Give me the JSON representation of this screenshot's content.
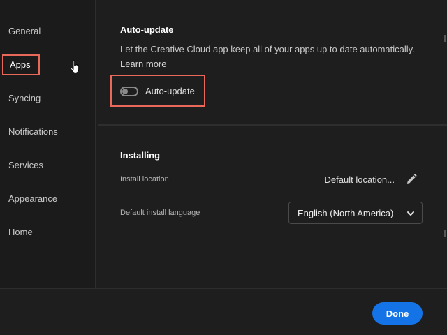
{
  "sidebar": {
    "items": [
      {
        "label": "General"
      },
      {
        "label": "Apps"
      },
      {
        "label": "Syncing"
      },
      {
        "label": "Notifications"
      },
      {
        "label": "Services"
      },
      {
        "label": "Appearance"
      },
      {
        "label": "Home"
      }
    ],
    "active_index": 1
  },
  "autoupdate_section": {
    "title": "Auto-update",
    "description": "Let the Creative Cloud app keep all of your apps up to date automatically.",
    "learn_more": "Learn more",
    "toggle_label": "Auto-update",
    "toggle_on": false
  },
  "installing_section": {
    "title": "Installing",
    "install_location_label": "Install location",
    "install_location_value": "Default location...",
    "language_label": "Default install language",
    "language_value": "English (North America)"
  },
  "footer": {
    "done_label": "Done"
  },
  "colors": {
    "accent": "#1473e6",
    "highlight": "#e8685a"
  },
  "icons": {
    "edit": "pencil-icon",
    "dropdown": "chevron-down-icon",
    "cursor": "hand-cursor-icon"
  }
}
